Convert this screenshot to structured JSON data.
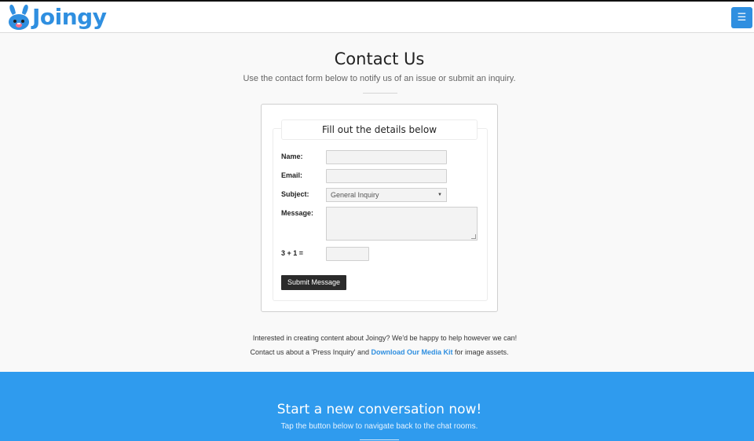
{
  "brand": {
    "name": "Joingy",
    "color": "#2f8fe0"
  },
  "header": {
    "menu_icon": "hamburger-icon"
  },
  "page": {
    "title": "Contact Us",
    "subtitle": "Use the contact form below to notify us of an issue or submit an inquiry."
  },
  "form": {
    "legend": "Fill out the details below",
    "name_label": "Name:",
    "email_label": "Email:",
    "subject_label": "Subject:",
    "subject_value": "General Inquiry",
    "message_label": "Message:",
    "captcha_label": "3 + 1 =",
    "submit_label": "Submit Message"
  },
  "notes": {
    "line1": "Interested in creating content about Joingy? We'd be happy to help however we can!",
    "line2_prefix": "Contact us about a 'Press Inquiry' and ",
    "line2_link": "Download Our Media Kit",
    "line2_suffix": " for image assets."
  },
  "footer": {
    "title": "Start a new conversation now!",
    "subtitle": "Tap the button below to navigate back to the chat rooms.",
    "bg_color": "#2f9bee"
  }
}
